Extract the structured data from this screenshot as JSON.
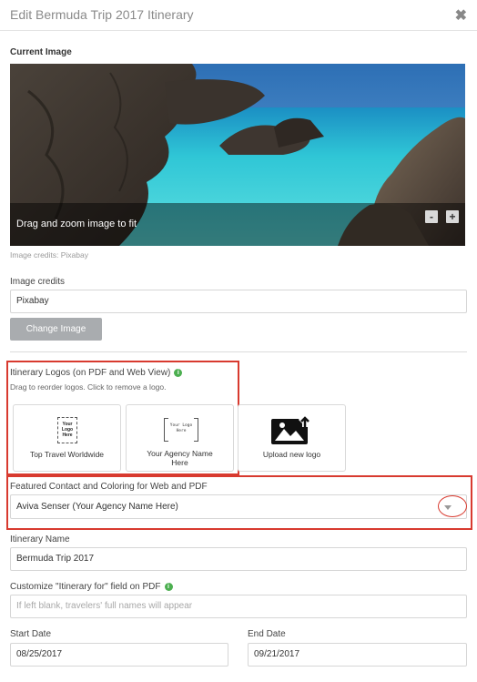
{
  "dialog": {
    "title": "Edit Bermuda Trip 2017 Itinerary",
    "close_glyph": "✖"
  },
  "current_image": {
    "heading": "Current Image",
    "overlay_text": "Drag and zoom image to fit",
    "zoom_out": "-",
    "zoom_in": "+",
    "credits_note": "Image credits: Pixabay"
  },
  "image_credits": {
    "label": "Image credits",
    "value": "Pixabay"
  },
  "change_image_label": "Change Image",
  "logos": {
    "heading": "Itinerary Logos (on PDF and Web View)",
    "hint": "Drag to reorder logos. Click to remove a logo.",
    "info_glyph": "i",
    "cards": [
      {
        "label": "Top Travel Worldwide",
        "logo_text": "Your Logo Here",
        "logo_lines": [
          "Your",
          "Logo",
          "Here"
        ]
      },
      {
        "label_lines": [
          "Your Agency Name",
          "Here"
        ],
        "logo_lines": [
          "Your Logo",
          "Here"
        ]
      },
      {
        "label": "Upload new logo",
        "icon": "image-upload-icon"
      }
    ]
  },
  "featured_contact": {
    "label": "Featured Contact and Coloring for Web and PDF",
    "selected": "Aviva Senser (Your Agency Name Here)"
  },
  "itinerary_name": {
    "label": "Itinerary Name",
    "value": "Bermuda Trip 2017"
  },
  "itinerary_for": {
    "label": "Customize \"Itinerary for\" field on PDF",
    "info_glyph": "i",
    "placeholder": "If left blank, travelers' full names will appear"
  },
  "start_date": {
    "label": "Start Date",
    "value": "08/25/2017"
  },
  "end_date": {
    "label": "End Date",
    "value": "09/21/2017"
  },
  "colors": {
    "highlight_red": "#d83a2f",
    "info_green": "#4caf50",
    "button_gray": "#a9acaf",
    "sea_turquoise": "#2fc6d6"
  }
}
